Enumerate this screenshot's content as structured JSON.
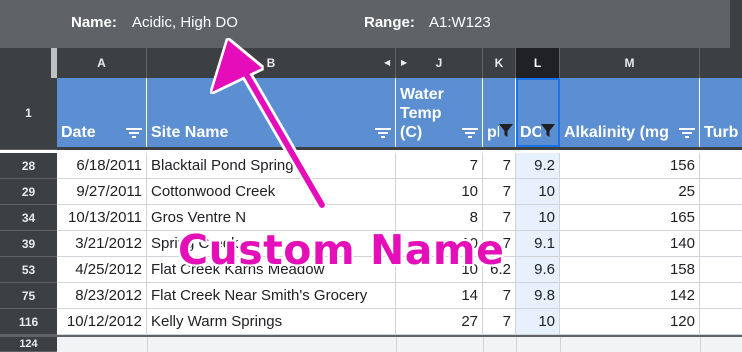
{
  "filter_view": {
    "name_label": "Name:",
    "name_value": "Acidic, High DO",
    "range_label": "Range:",
    "range_value": "A1:W123"
  },
  "columns": [
    "A",
    "B",
    "J",
    "K",
    "L",
    "M"
  ],
  "header_row_number": "1",
  "headers": {
    "date": "Date",
    "site_name": "Site Name",
    "water_temp": "Water\nTemp\n(C)",
    "ph": "pH",
    "do": "DO",
    "alkalinity": "Alkalinity (mg",
    "turbidity": "Turb"
  },
  "rows": [
    {
      "row": "28",
      "date": "6/18/2011",
      "site": "Blacktail Pond Springs",
      "temp": "7",
      "ph": "7",
      "do": "9.2",
      "alk": "156"
    },
    {
      "row": "29",
      "date": "9/27/2011",
      "site": "Cottonwood Creek",
      "temp": "10",
      "ph": "7",
      "do": "10",
      "alk": "25"
    },
    {
      "row": "34",
      "date": "10/13/2011",
      "site": "Gros Ventre N",
      "temp": "8",
      "ph": "7",
      "do": "10",
      "alk": "165"
    },
    {
      "row": "39",
      "date": "3/21/2012",
      "site": "Spring Creek",
      "temp": "10",
      "ph": "7",
      "do": "9.1",
      "alk": "140"
    },
    {
      "row": "53",
      "date": "4/25/2012",
      "site": "Flat Creek Karns Meadow",
      "temp": "10",
      "ph": "6.2",
      "do": "9.6",
      "alk": "158"
    },
    {
      "row": "75",
      "date": "8/23/2012",
      "site": "Flat Creek Near Smith's Grocery",
      "temp": "14",
      "ph": "7",
      "do": "9.8",
      "alk": "142"
    },
    {
      "row": "116",
      "date": "10/12/2012",
      "site": "Kelly Warm Springs",
      "temp": "27",
      "ph": "7",
      "do": "10",
      "alk": "120"
    }
  ],
  "last_row_number": "124",
  "annotation": {
    "text": "Custom Name",
    "color": "#e40fb9"
  },
  "colors": {
    "header_blue": "#5b8fd1",
    "toolbar_gray": "#5f6368",
    "header_dark": "#3c4043",
    "selection_blue": "#1a73e8"
  }
}
